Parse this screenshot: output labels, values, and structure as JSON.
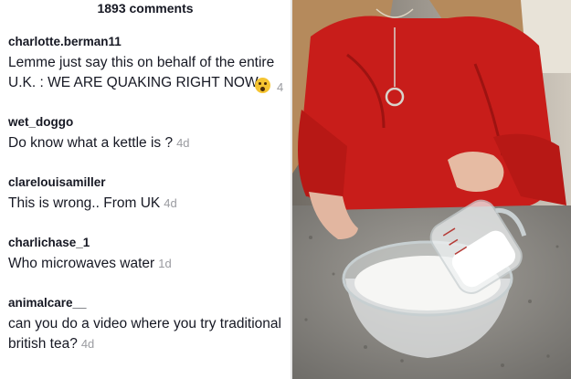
{
  "comments_header": "1893 comments",
  "comments": [
    {
      "username": "charlotte.berman11",
      "text": "Lemme just say this on behalf of the entire U.K. : WE ARE QUAKING RIGHT NOW",
      "time": "4",
      "emoji": "astonished-face"
    },
    {
      "username": "wet_doggo",
      "text": "Do know what a kettle is ?",
      "time": "4d"
    },
    {
      "username": "clarelouisamiller",
      "text": "This is wrong.. From UK",
      "time": "4d"
    },
    {
      "username": "charlichase_1",
      "text": "Who microwaves water",
      "time": "1d"
    },
    {
      "username": "animalcare__",
      "text": "can you do a video where you try traditional british tea?",
      "time": "4d"
    }
  ],
  "photo": {
    "subject": "person in red sweater pouring sugar from a measuring cup into a glass bowl",
    "colors": {
      "sweater": "#c81d1a",
      "counter": "#8c8a86",
      "hair": "#b58a5c"
    }
  }
}
